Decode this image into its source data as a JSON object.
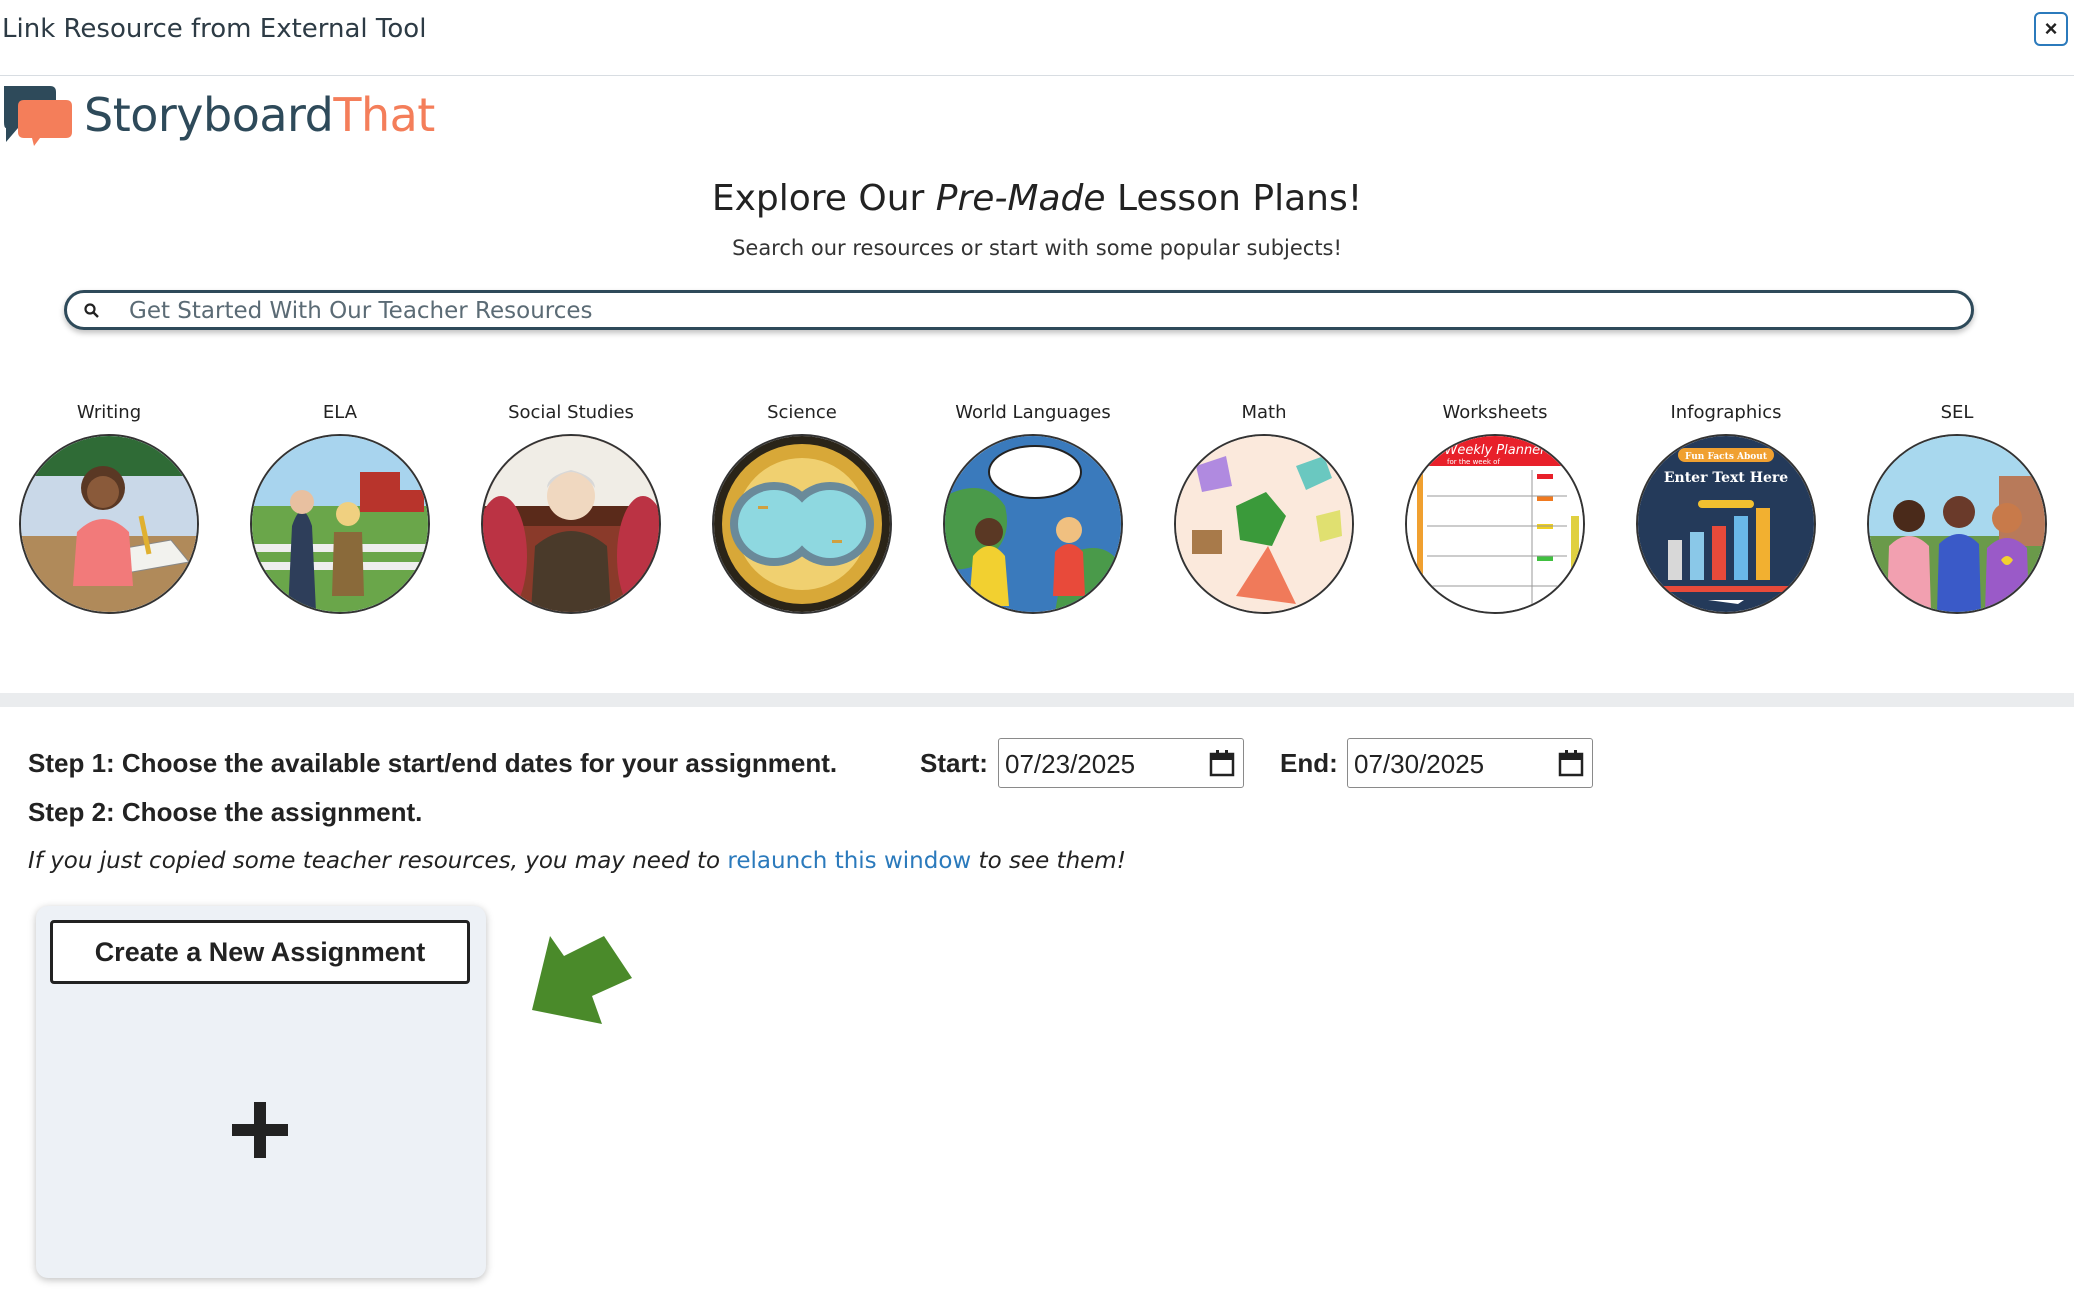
{
  "window": {
    "title": "Link Resource from External Tool",
    "close_label": "×"
  },
  "logo": {
    "part1": "Storyboard",
    "part2": "That"
  },
  "hero": {
    "title_pre": "Explore Our ",
    "title_em": "Pre-Made",
    "title_post": " Lesson Plans!",
    "subtitle": "Search our resources or start with some popular subjects!"
  },
  "search": {
    "placeholder": "Get Started With Our Teacher Resources",
    "value": ""
  },
  "subjects": [
    {
      "label": "Writing"
    },
    {
      "label": "ELA"
    },
    {
      "label": "Social Studies"
    },
    {
      "label": "Science"
    },
    {
      "label": "World Languages"
    },
    {
      "label": "Math"
    },
    {
      "label": "Worksheets"
    },
    {
      "label": "Infographics"
    },
    {
      "label": "SEL"
    }
  ],
  "thumb_text": {
    "weekly_planner": "Weekly Planner",
    "week_of": "for the week of",
    "fun_facts": "Fun Facts About",
    "enter_text": "Enter Text Here"
  },
  "steps": {
    "step1": "Step 1: Choose the available start/end dates for your assignment.",
    "step2": "Step 2: Choose the assignment.",
    "start_label": "Start:",
    "start_value": "07/23/2025",
    "end_label": "End:",
    "end_value": "07/30/2025"
  },
  "note": {
    "pre": "If you just copied some teacher resources, you may need to ",
    "link": "relaunch this window",
    "post": " to see them!"
  },
  "card": {
    "button_label": "Create a New Assignment"
  },
  "colors": {
    "accent": "#2b7abc",
    "logo_dark": "#2e4a5a",
    "logo_orange": "#f47e5a",
    "arrow_green": "#4a8a2a"
  }
}
